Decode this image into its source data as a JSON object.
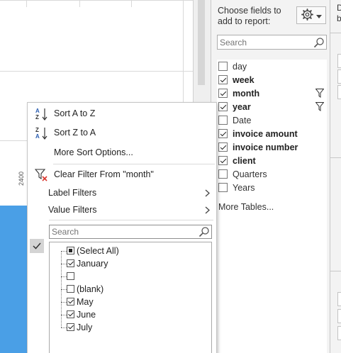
{
  "sheet": {
    "axis_label": "2400",
    "bar_color": "#4a9fe6"
  },
  "field_pane": {
    "title_line1": "Choose fields to",
    "title_line2": "add to report:",
    "settings_icon": "gear-icon",
    "search_placeholder": "Search",
    "fields": [
      {
        "label": "day",
        "checked": false,
        "bold": false,
        "filtered": false
      },
      {
        "label": "week",
        "checked": true,
        "bold": true,
        "filtered": false
      },
      {
        "label": "month",
        "checked": true,
        "bold": true,
        "filtered": true
      },
      {
        "label": "year",
        "checked": true,
        "bold": true,
        "filtered": true
      },
      {
        "label": "Date",
        "checked": false,
        "bold": false,
        "filtered": false
      },
      {
        "label": "invoice amount",
        "checked": true,
        "bold": true,
        "filtered": false
      },
      {
        "label": "invoice number",
        "checked": true,
        "bold": true,
        "filtered": false
      },
      {
        "label": "client",
        "checked": true,
        "bold": true,
        "filtered": false
      },
      {
        "label": "Quarters",
        "checked": false,
        "bold": false,
        "filtered": false
      },
      {
        "label": "Years",
        "checked": false,
        "bold": false,
        "filtered": false
      }
    ],
    "more_tables": "More Tables..."
  },
  "right_strip": {
    "text1": "D",
    "text2": "b"
  },
  "filter_menu": {
    "sort_az": "Sort A to Z",
    "sort_za": "Sort Z to A",
    "more_sort": "More Sort Options...",
    "clear_filter": "Clear Filter From \"month\"",
    "label_filters": "Label Filters",
    "value_filters": "Value Filters",
    "search_placeholder": "Search",
    "values": [
      {
        "label": "(Select All)",
        "state": "partial"
      },
      {
        "label": "January",
        "state": "checked"
      },
      {
        "label": "",
        "state": "unchecked"
      },
      {
        "label": "(blank)",
        "state": "unchecked"
      },
      {
        "label": "May",
        "state": "checked"
      },
      {
        "label": "June",
        "state": "checked"
      },
      {
        "label": "July",
        "state": "checked"
      }
    ]
  }
}
